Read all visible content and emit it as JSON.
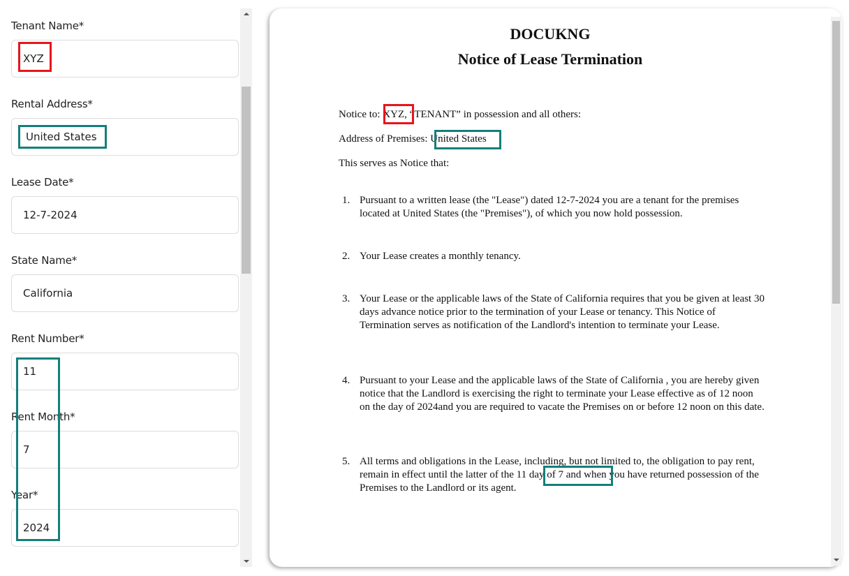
{
  "form": {
    "fields": [
      {
        "label": "Tenant Name*",
        "value": "XYZ"
      },
      {
        "label": "Rental Address*",
        "value": "United States"
      },
      {
        "label": "Lease Date*",
        "value": "12-7-2024"
      },
      {
        "label": "State Name*",
        "value": "California"
      },
      {
        "label": "Rent Number*",
        "value": "11"
      },
      {
        "label": "Rent Month*",
        "value": "7"
      },
      {
        "label": "Year*",
        "value": "2024"
      }
    ]
  },
  "document": {
    "brand": "DOCUKNG",
    "title": "Notice of Lease Termination",
    "notice_prefix": "Notice to: ",
    "tenant_name": "XYZ,",
    "notice_suffix": " “TENANT” in possession and all others:",
    "address_prefix": "Address of Premises: ",
    "address": "United States",
    "serves_notice": "This serves as Notice that:",
    "items": [
      {
        "num": "1.",
        "text": "Pursuant to a written lease (the \"Lease\") dated 12-7-2024 you are a tenant for the premises located at United States (the \"Premises\"), of which you now hold possession."
      },
      {
        "num": "2.",
        "text": "Your Lease creates a monthly tenancy."
      },
      {
        "num": "3.",
        "text": "Your Lease or the applicable laws of the State of California requires that you be given at least 30 days advance notice prior to the termination of your Lease or tenancy. This Notice of Termination serves as notification of the Landlord's intention to terminate your Lease."
      },
      {
        "num": "4.",
        "text": "Pursuant to your Lease and the applicable laws of the State of California , you are hereby given notice that the Landlord is exercising the right to terminate your Lease effective as of 12 noon on the day of 2024and you are required to vacate the Premises on or before 12 noon on this date."
      },
      {
        "num": "5.",
        "text": "All terms and obligations in the Lease, including, but not limited to, the obligation to pay rent, remain in effect until the latter of the 11 day of 7 and when you have returned possession of the Premises to the Landlord or its agent."
      }
    ]
  },
  "annotations": {
    "red": "#e8141b",
    "teal": "#137f7a"
  }
}
